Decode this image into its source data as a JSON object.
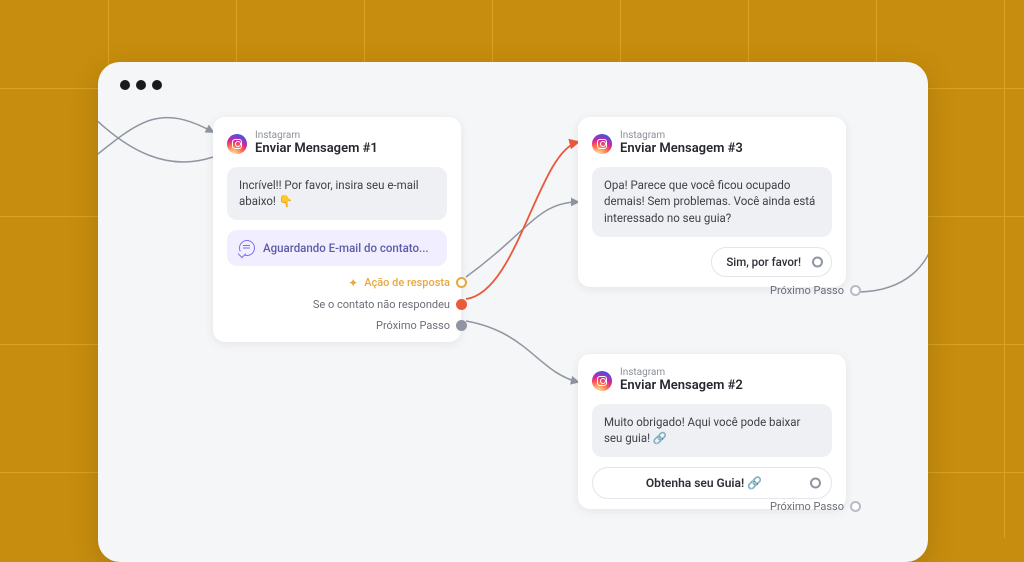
{
  "platform_label": "Instagram",
  "cards": {
    "msg1": {
      "title": "Enviar Mensagem #1",
      "bubble": "Incrível!! Por favor, insira seu e-mail abaixo! 👇",
      "waiting": "Aguardando E-mail do contato...",
      "ports": {
        "action": "Ação de resposta",
        "noreply": "Se o contato não respondeu",
        "next": "Próximo Passo"
      }
    },
    "msg2": {
      "title": "Enviar Mensagem #2",
      "bubble": "Muito obrigado! Aqui você pode baixar seu guia! 🔗",
      "cta": "Obtenha seu Guia! 🔗",
      "next": "Próximo Passo"
    },
    "msg3": {
      "title": "Enviar Mensagem #3",
      "bubble": "Opa! Parece que você ficou ocupado demais! Sem problemas. Você ainda está interessado no seu guia?",
      "option": "Sim, por favor!",
      "next": "Próximo Passo"
    }
  }
}
